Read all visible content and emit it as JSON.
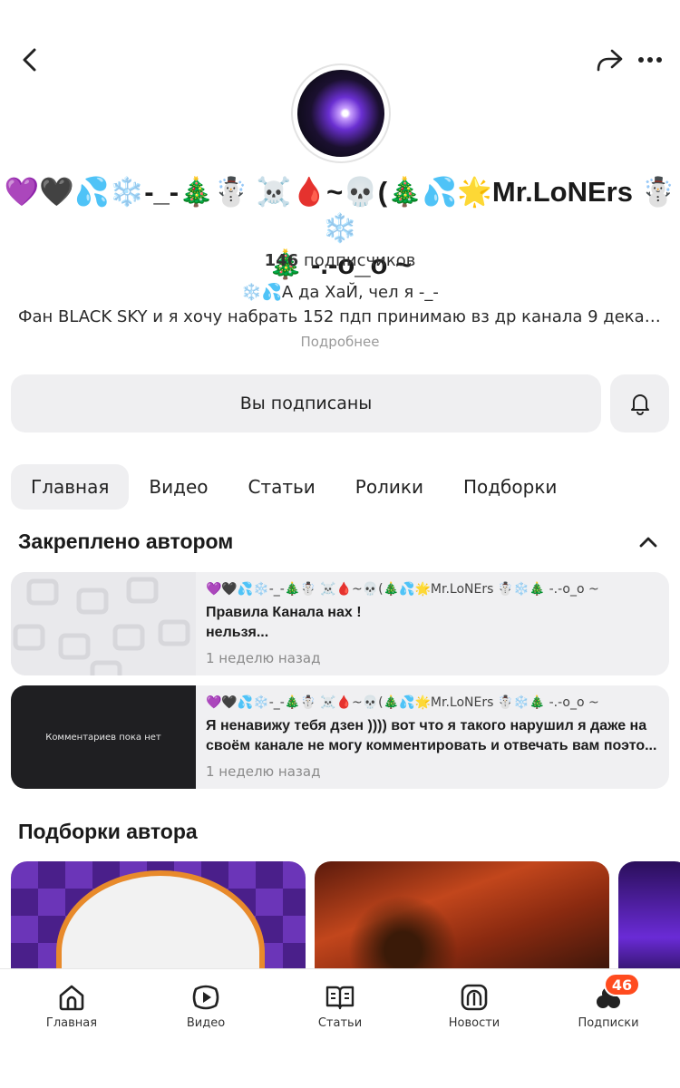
{
  "header": {
    "channel_name_line1": "💜🖤💦❄️-_-🎄☃️ ☠️🩸~💀(🎄💦🌟Mr.LoNErs ☃️❄️",
    "channel_name_line2": "🎄 -.-o_o ~",
    "subscribers_count": "146",
    "subscribers_label": "подписчиков",
    "bio_line1": "❄️💦А да  ХаЙ,  чел я -_-",
    "bio_line2": "Фан BLACK SKY и я хочу набрать 152 пдп  принимаю вз др канала 9 декаб...",
    "more_label": "Подробнее"
  },
  "actions": {
    "subscribed_label": "Вы подписаны"
  },
  "tabs": [
    {
      "label": "Главная",
      "active": true
    },
    {
      "label": "Видео",
      "active": false
    },
    {
      "label": "Статьи",
      "active": false
    },
    {
      "label": "Ролики",
      "active": false
    },
    {
      "label": "Подборки",
      "active": false
    }
  ],
  "pinned": {
    "title": "Закреплено автором",
    "cards": [
      {
        "author": "💜🖤💦❄️-_-🎄☃️ ☠️🩸~💀(🎄💦🌟Mr.LoNErs ☃️❄️🎄  -.-o_o ~",
        "text": "Правила Канала нах !\nнельзя...",
        "time": "1 неделю назад"
      },
      {
        "author": "💜🖤💦❄️-_-🎄☃️ ☠️🩸~💀(🎄💦🌟Mr.LoNErs ☃️❄️🎄  -.-o_o ~",
        "thumb_text": "Комментариев пока нет",
        "text": "Я ненавижу тебя дзен )))) вот что я такого нарушил я даже на своём канале не могу комментировать и отвечать вам поэто...",
        "time": "1 неделю назад"
      }
    ]
  },
  "collections": {
    "title": "Подборки автора"
  },
  "bottom_nav": [
    {
      "label": "Главная",
      "icon": "home-icon"
    },
    {
      "label": "Видео",
      "icon": "play-icon"
    },
    {
      "label": "Статьи",
      "icon": "book-icon"
    },
    {
      "label": "Новости",
      "icon": "news-icon"
    },
    {
      "label": "Подписки",
      "icon": "subscriptions-icon",
      "badge": "46"
    }
  ],
  "colors": {
    "badge": "#ff4b1e",
    "surface": "#efeff1"
  }
}
